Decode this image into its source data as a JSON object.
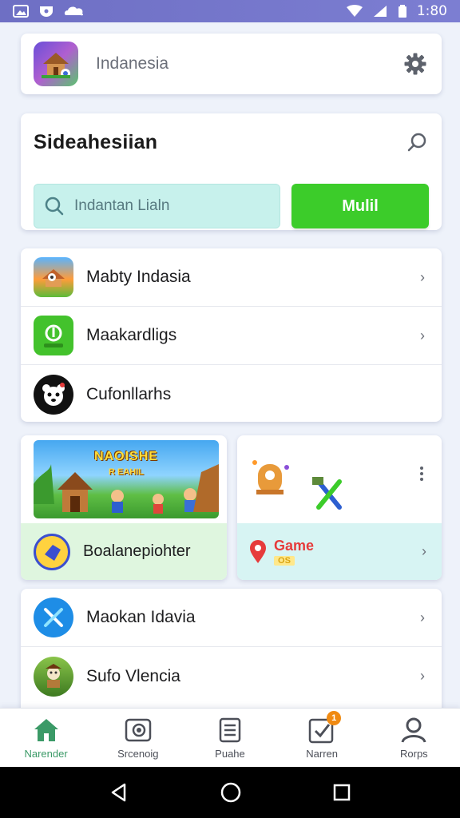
{
  "status_bar": {
    "time": "1:80"
  },
  "app_header": {
    "title": "Indanesia"
  },
  "search_card": {
    "title": "Sideahesiian",
    "input_placeholder": "Indantan Lialn",
    "button_label": "Mulil"
  },
  "list_1": [
    {
      "label": "Mabty Indasia",
      "icon": "game-hut-icon",
      "color": "#ff8f3a"
    },
    {
      "label": "Maakardligs",
      "icon": "leaf-app-icon",
      "color": "#43c22c"
    },
    {
      "label": "Cufonllarhs",
      "icon": "panda-icon",
      "color": "#111111"
    }
  ],
  "tile_left": {
    "banner_title": "NAOISHE",
    "banner_sub": "R EAHIL",
    "label": "Boalanepiohter"
  },
  "tile_right": {
    "game_label": "Game",
    "game_sub": "OS"
  },
  "list_2": [
    {
      "label": "Maokan Idavia",
      "icon": "cross-swords-icon",
      "color": "#1e8de6"
    },
    {
      "label": "Sufo Vlencia",
      "icon": "character-icon",
      "color": "#5a8f2f"
    }
  ],
  "bottom_nav": [
    {
      "label": "Narender",
      "icon": "home-icon",
      "active": true
    },
    {
      "label": "Srcenoig",
      "icon": "camera-icon",
      "active": false
    },
    {
      "label": "Puahe",
      "icon": "notes-icon",
      "active": false
    },
    {
      "label": "Narren",
      "icon": "tasks-icon",
      "active": false,
      "badge": "1"
    },
    {
      "label": "Rorps",
      "icon": "profile-icon",
      "active": false
    }
  ],
  "colors": {
    "status_bar": "#7475c9",
    "primary_green": "#3ccc2a",
    "search_bg": "#c7f1ec",
    "active_nav": "#3b9a67"
  }
}
